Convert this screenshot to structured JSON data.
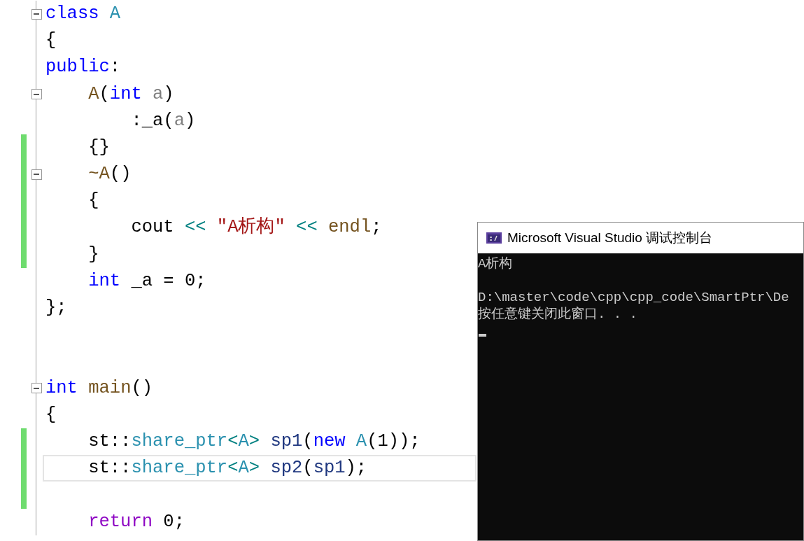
{
  "editor": {
    "lines": [
      {
        "fold": true,
        "changed": false,
        "current": false,
        "tokens": [
          {
            "kind": "keyword",
            "text": "class "
          },
          {
            "kind": "type",
            "text": "A"
          }
        ]
      },
      {
        "fold": false,
        "changed": false,
        "current": false,
        "tokens": [
          {
            "kind": "plain",
            "text": "{"
          }
        ]
      },
      {
        "fold": false,
        "changed": false,
        "current": false,
        "tokens": [
          {
            "kind": "keyword",
            "text": "public"
          },
          {
            "kind": "plain",
            "text": ":"
          }
        ]
      },
      {
        "fold": true,
        "changed": false,
        "current": false,
        "tokens": [
          {
            "kind": "function",
            "text": "    A"
          },
          {
            "kind": "plain",
            "text": "("
          },
          {
            "kind": "keyword",
            "text": "int "
          },
          {
            "kind": "param",
            "text": "a"
          },
          {
            "kind": "plain",
            "text": ")"
          }
        ]
      },
      {
        "fold": false,
        "changed": false,
        "current": false,
        "tokens": [
          {
            "kind": "plain",
            "text": "        :_a("
          },
          {
            "kind": "param",
            "text": "a"
          },
          {
            "kind": "plain",
            "text": ")"
          }
        ]
      },
      {
        "fold": false,
        "changed": true,
        "current": false,
        "tokens": [
          {
            "kind": "plain",
            "text": "    {}"
          }
        ]
      },
      {
        "fold": true,
        "changed": true,
        "current": false,
        "tokens": [
          {
            "kind": "function",
            "text": "    ~A"
          },
          {
            "kind": "plain",
            "text": "()"
          }
        ]
      },
      {
        "fold": false,
        "changed": true,
        "current": false,
        "tokens": [
          {
            "kind": "plain",
            "text": "    {"
          }
        ]
      },
      {
        "fold": false,
        "changed": true,
        "current": false,
        "tokens": [
          {
            "kind": "plain",
            "text": "        cout "
          },
          {
            "kind": "operator",
            "text": "<< "
          },
          {
            "kind": "string",
            "text": "\"A析构\" "
          },
          {
            "kind": "operator",
            "text": "<< "
          },
          {
            "kind": "function",
            "text": "endl"
          },
          {
            "kind": "plain",
            "text": ";"
          }
        ]
      },
      {
        "fold": false,
        "changed": true,
        "current": false,
        "tokens": [
          {
            "kind": "plain",
            "text": "    }"
          }
        ]
      },
      {
        "fold": false,
        "changed": false,
        "current": false,
        "tokens": [
          {
            "kind": "keyword",
            "text": "    int"
          },
          {
            "kind": "plain",
            "text": " _a = 0;"
          }
        ]
      },
      {
        "fold": false,
        "changed": false,
        "current": false,
        "tokens": [
          {
            "kind": "plain",
            "text": "};"
          }
        ]
      },
      {
        "fold": false,
        "changed": false,
        "current": false
      },
      {
        "fold": false,
        "changed": false,
        "current": false
      },
      {
        "fold": true,
        "changed": false,
        "current": false,
        "tokens": [
          {
            "kind": "keyword",
            "text": "int "
          },
          {
            "kind": "function",
            "text": "main"
          },
          {
            "kind": "plain",
            "text": "()"
          }
        ]
      },
      {
        "fold": false,
        "changed": false,
        "current": false,
        "tokens": [
          {
            "kind": "plain",
            "text": "{"
          }
        ]
      },
      {
        "fold": false,
        "changed": true,
        "current": false,
        "tokens": [
          {
            "kind": "plain",
            "text": "    st::"
          },
          {
            "kind": "type",
            "text": "share_ptr"
          },
          {
            "kind": "operator",
            "text": "<"
          },
          {
            "kind": "type",
            "text": "A"
          },
          {
            "kind": "operator",
            "text": "> "
          },
          {
            "kind": "variable",
            "text": "sp1"
          },
          {
            "kind": "plain",
            "text": "("
          },
          {
            "kind": "keyword",
            "text": "new "
          },
          {
            "kind": "type",
            "text": "A"
          },
          {
            "kind": "plain",
            "text": "(1));"
          }
        ]
      },
      {
        "fold": false,
        "changed": true,
        "current": true,
        "tokens": [
          {
            "kind": "plain",
            "text": "    st::"
          },
          {
            "kind": "type",
            "text": "share_ptr"
          },
          {
            "kind": "operator",
            "text": "<"
          },
          {
            "kind": "type",
            "text": "A"
          },
          {
            "kind": "operator",
            "text": "> "
          },
          {
            "kind": "variable",
            "text": "sp2"
          },
          {
            "kind": "plain",
            "text": "("
          },
          {
            "kind": "variable",
            "text": "sp1"
          },
          {
            "kind": "plain",
            "text": ");"
          }
        ]
      },
      {
        "fold": false,
        "changed": true,
        "current": false
      },
      {
        "fold": false,
        "changed": false,
        "current": false,
        "tokens": [
          {
            "kind": "control",
            "text": "    return"
          },
          {
            "kind": "plain",
            "text": " 0;"
          }
        ]
      }
    ]
  },
  "console": {
    "title": "Microsoft Visual Studio 调试控制台",
    "lines": [
      {
        "kind": "text",
        "text": "A析构"
      },
      {
        "kind": "blank"
      },
      {
        "kind": "text",
        "text": "D:\\master\\code\\cpp\\cpp_code\\SmartPtr\\De"
      },
      {
        "kind": "text",
        "text": "按任意键关闭此窗口. . ."
      }
    ]
  }
}
